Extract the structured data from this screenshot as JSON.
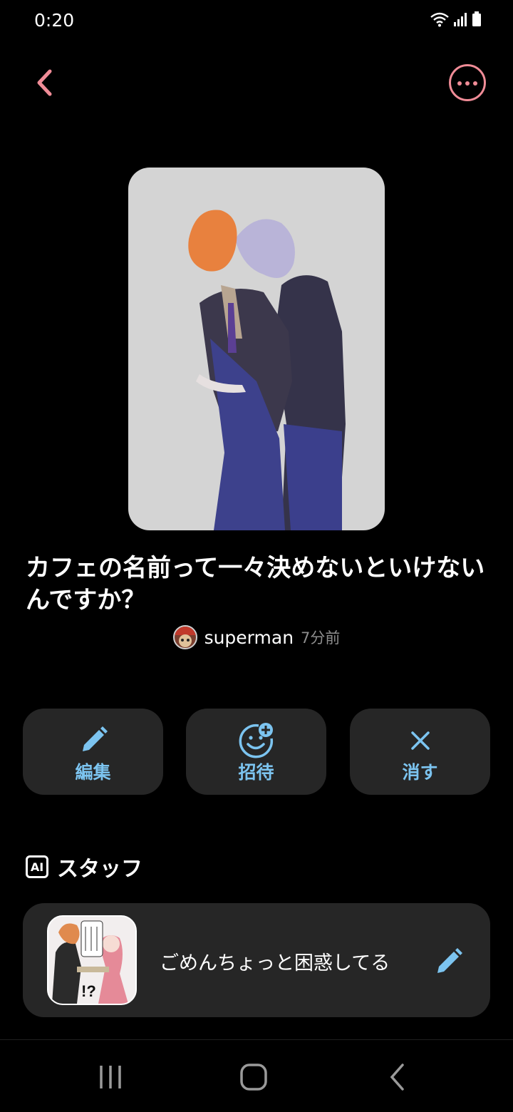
{
  "status": {
    "time": "0:20"
  },
  "post": {
    "title": "カフェの名前って一々決めないといけないんですか？",
    "author": "superman",
    "posted": "7分前"
  },
  "actions": [
    {
      "label": "編集",
      "icon": "pencil-icon"
    },
    {
      "label": "招待",
      "icon": "face-plus-icon"
    },
    {
      "label": "消す",
      "icon": "close-icon"
    }
  ],
  "staff": {
    "badge": "AI",
    "title": "スタッフ",
    "message": "ごめんちょっと困惑してる",
    "thumb_text": "!?"
  },
  "colors": {
    "accent_pink": "#f08c97",
    "accent_blue": "#7cc4f0",
    "card_bg": "#262626"
  }
}
